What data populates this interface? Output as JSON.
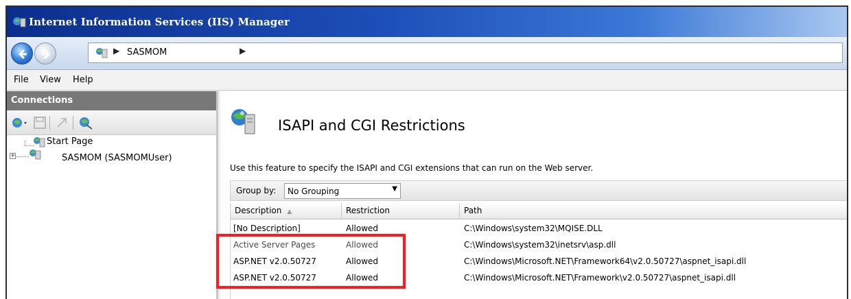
{
  "window": {
    "title": "Internet Information Services (IIS) Manager",
    "icon": "iis-app-icon"
  },
  "navigation": {
    "back_icon": "back-arrow-icon",
    "forward_icon": "forward-arrow-icon",
    "breadcrumb": "SASMOM"
  },
  "menu": {
    "items": [
      "File",
      "View",
      "Help"
    ]
  },
  "connections": {
    "header": "Connections",
    "tree": [
      {
        "label": "Start Page"
      },
      {
        "label": "SASMOM (SASMOMUser)"
      }
    ]
  },
  "feature": {
    "title": "ISAPI and CGI Restrictions",
    "description": "Use this feature to specify the ISAPI and CGI extensions that can run on the Web server."
  },
  "group_by": {
    "label": "Group by:",
    "value": "No Grouping"
  },
  "table": {
    "columns": [
      "Description",
      "Restriction",
      "Path"
    ],
    "rows": [
      {
        "description": "[No Description]",
        "restriction": "Allowed",
        "path": "C:\\Windows\\system32\\MQISE.DLL"
      },
      {
        "description": "Active Server Pages",
        "restriction": "Allowed",
        "path": "C:\\Windows\\system32\\inetsrv\\asp.dll"
      },
      {
        "description": "ASP.NET v2.0.50727",
        "restriction": "Allowed",
        "path": "C:\\Windows\\Microsoft.NET\\Framework64\\v2.0.50727\\aspnet_isapi.dll"
      },
      {
        "description": "ASP.NET v2.0.50727",
        "restriction": "Allowed",
        "path": "C:\\Windows\\Microsoft.NET\\Framework\\v2.0.50727\\aspnet_isapi.dll"
      }
    ]
  },
  "colors": {
    "titlebar": "#0b2e8c",
    "highlight": "#ff1b1b",
    "connections_header": "#787878"
  }
}
